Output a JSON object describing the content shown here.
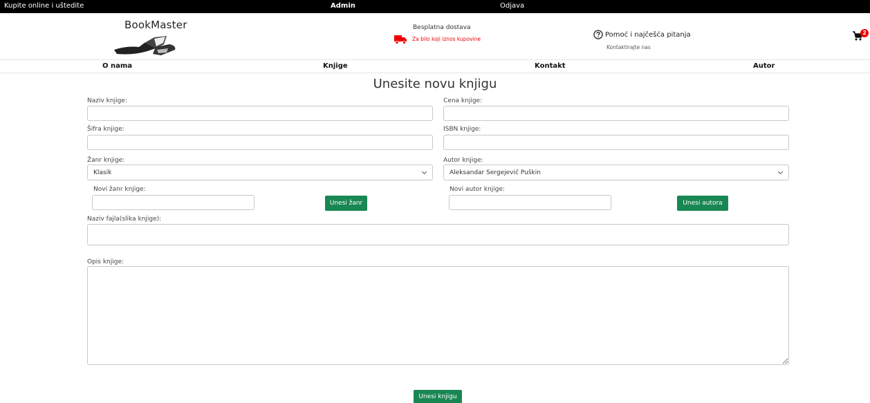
{
  "topbar": {
    "slogan": "Kupite online i uštedite",
    "admin": "Admin",
    "logout": "Odjava"
  },
  "header": {
    "logo_text": "BookMaster",
    "shipping_title": "Besplatna dostava",
    "shipping_sub": "Za bilo koji iznos kupovine",
    "help_title": "Pomoć i najčešća pitanja",
    "help_sub": "Kontaktirajte nas",
    "cart_count": "2"
  },
  "nav": {
    "items": [
      "O nama",
      "Knjige",
      "Kontakt",
      "Autor"
    ]
  },
  "form": {
    "title": "Unesite novu knjigu",
    "name_label": "Naziv knjige:",
    "price_label": "Cena knjige:",
    "code_label": "Šifra knjige:",
    "isbn_label": "ISBN knjige:",
    "genre_label": "Žanr knjige:",
    "genre_selected": "Klasik",
    "author_label": "Autor knjige:",
    "author_selected": "Aleksandar Sergejevič Puškin",
    "new_genre_label": "Novi žanr knjige:",
    "new_genre_button": "Unesi žanr",
    "new_author_label": "Novi autor knjige:",
    "new_author_button": "Unesi autora",
    "file_label": "Naziv fajla(slika knjige):",
    "description_label": "Opis knjige:",
    "submit_button": "Unesi knjigu"
  },
  "colors": {
    "accent_green": "#198754",
    "alert_red": "#e00000",
    "topbar_bg": "#000000"
  }
}
